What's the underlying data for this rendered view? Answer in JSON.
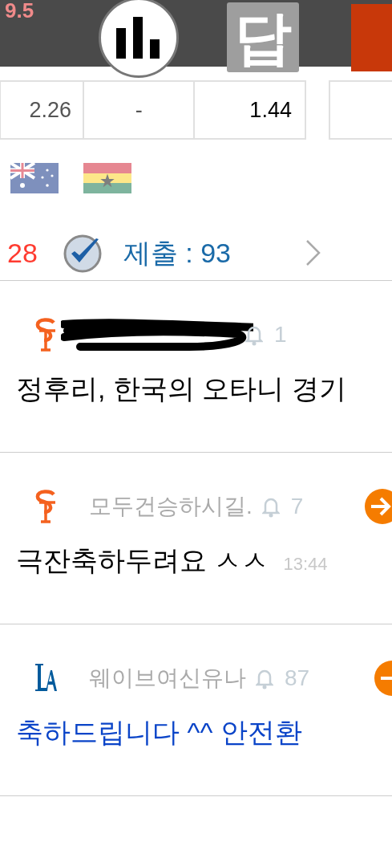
{
  "header": {
    "score": "9.5",
    "answer_tile": "답"
  },
  "odds": [
    "2.26",
    "-",
    "1.44"
  ],
  "summary": {
    "count": "28",
    "checked": true,
    "submitted": "제출 : 93"
  },
  "comments": [
    {
      "logo": {
        "kind": "sf"
      },
      "redacted": true,
      "likes": "1",
      "body": "정후리, 한국의 오타니 경기",
      "highlighted": false
    },
    {
      "logo": {
        "kind": "sf"
      },
      "redacted": false,
      "name": "모두건승하시길.",
      "likes": "7",
      "action": {
        "kind": "arrow"
      },
      "body": "극잔축하두려요 ㅅㅅ",
      "time": "13:44",
      "highlighted": false
    },
    {
      "logo": {
        "kind": "la"
      },
      "redacted": false,
      "name": "웨이브여신유나",
      "likes": "87",
      "action": {
        "kind": "minus"
      },
      "body": "축하드립니다 ^^ 안전환",
      "highlighted": true
    }
  ]
}
